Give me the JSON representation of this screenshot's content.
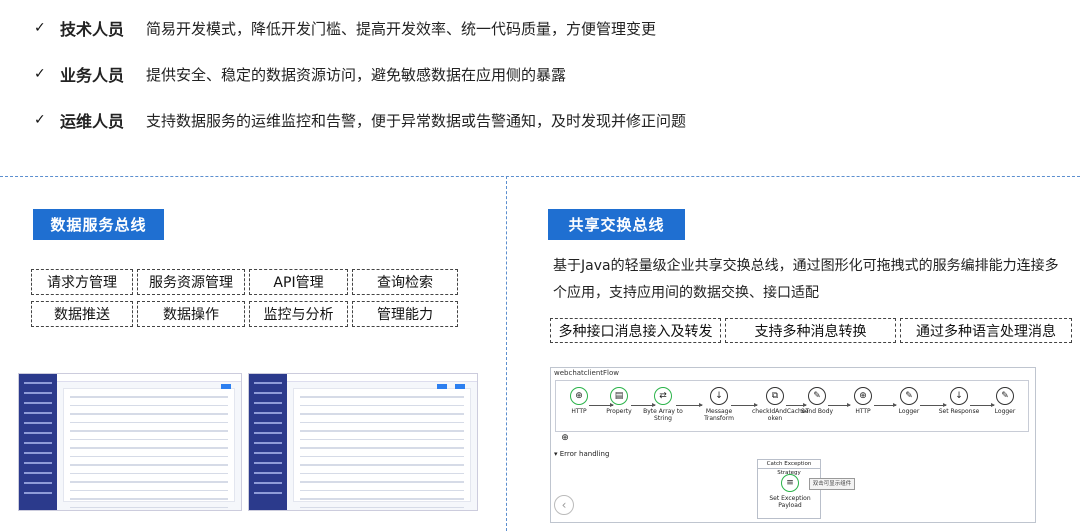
{
  "bullets": [
    {
      "role": "技术人员",
      "desc": "简易开发模式，降低开发门槛、提高开发效率、统一代码质量，方便管理变更"
    },
    {
      "role": "业务人员",
      "desc": "提供安全、稳定的数据资源访问，避免敏感数据在应用侧的暴露"
    },
    {
      "role": "运维人员",
      "desc": "支持数据服务的运维监控和告警，便于异常数据或告警通知，及时发现并修正问题"
    }
  ],
  "check_mark": "✓",
  "data_bus": {
    "title": "数据服务总线",
    "items": [
      "请求方管理",
      "服务资源管理",
      "API管理",
      "查询检索",
      "数据推送",
      "数据操作",
      "监控与分析",
      "管理能力"
    ]
  },
  "share_bus": {
    "title": "共享交换总线",
    "description": "基于Java的轻量级企业共享交换总线，通过图形化可拖拽式的服务编排能力连接多个应用，支持应用间的数据交换、接口适配",
    "features": [
      "多种接口消息接入及转发",
      "支持多种消息转换",
      "通过多种语言处理消息"
    ]
  },
  "flow": {
    "title": "webchatclientFlow",
    "nodes": [
      "HTTP",
      "Property",
      "Byte Array to String",
      "Message Transform",
      "checkIdAndCacheT oken",
      "Send Body",
      "HTTP",
      "Logger",
      "Set Response",
      "Logger"
    ],
    "error_label": "Error handling",
    "catch_title": "Catch Exception Strategy",
    "catch_node": "Set Exception Payload",
    "tooltip": "双击可显示组件"
  },
  "colors": {
    "accent": "#1f6fd1",
    "divider": "#5c8fcf",
    "sidebar": "#2b3a8c"
  }
}
